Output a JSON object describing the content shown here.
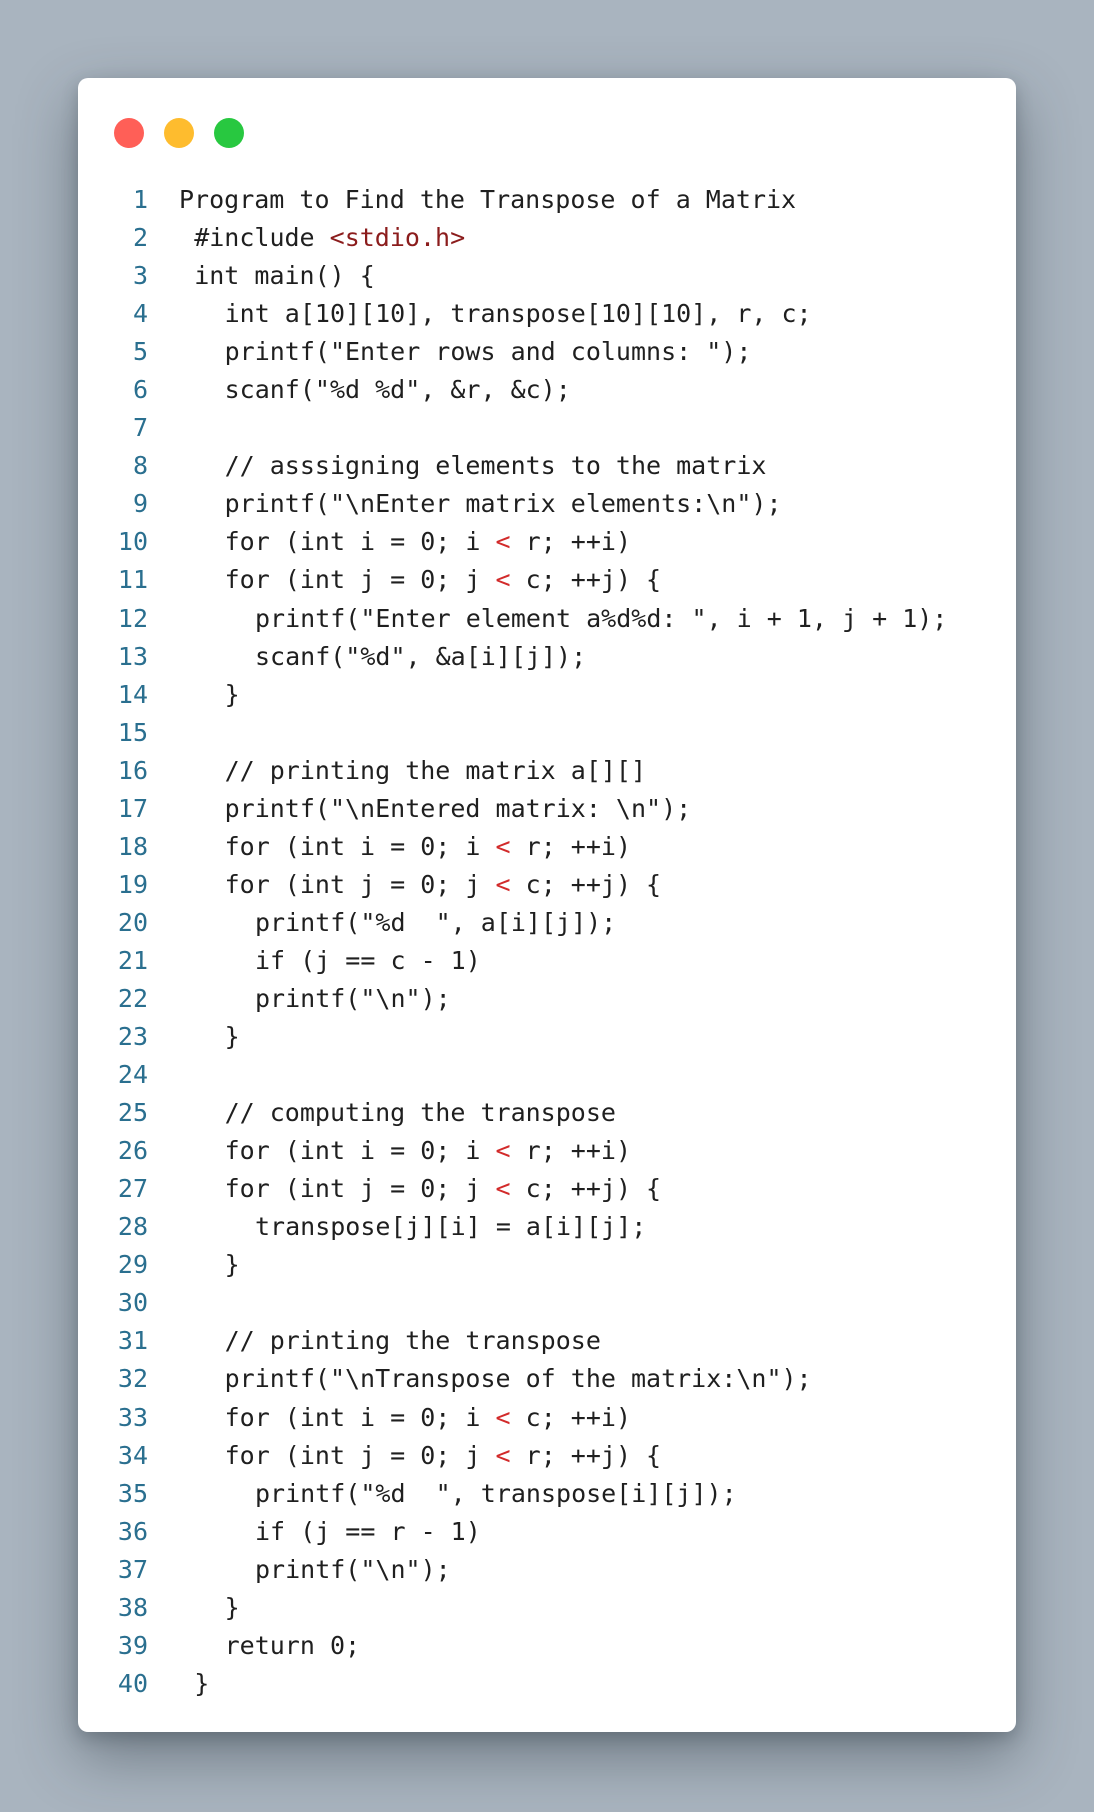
{
  "window": {
    "controls": [
      "close",
      "minimize",
      "maximize"
    ],
    "colors": {
      "close": "#ff5f57",
      "minimize": "#febc2e",
      "maximize": "#28c840"
    }
  },
  "code": {
    "language": "c",
    "line_number_color": "#2a6f8f",
    "lines": [
      {
        "n": "1",
        "indent": 0,
        "parts": [
          [
            "Program to Find the Transpose of a Matrix",
            ""
          ]
        ]
      },
      {
        "n": "2",
        "indent": 1,
        "parts": [
          [
            "#include ",
            ""
          ],
          [
            "<stdio.h>",
            "kw-str"
          ]
        ]
      },
      {
        "n": "3",
        "indent": 1,
        "parts": [
          [
            "int main() {",
            ""
          ]
        ]
      },
      {
        "n": "4",
        "indent": 3,
        "parts": [
          [
            "int a[10][10], transpose[10][10], r, c;",
            ""
          ]
        ]
      },
      {
        "n": "5",
        "indent": 3,
        "parts": [
          [
            "printf(\"Enter rows and columns: \");",
            ""
          ]
        ]
      },
      {
        "n": "6",
        "indent": 3,
        "parts": [
          [
            "scanf(\"%d %d\", &r, &c);",
            ""
          ]
        ]
      },
      {
        "n": "7",
        "indent": 0,
        "parts": []
      },
      {
        "n": "8",
        "indent": 3,
        "parts": [
          [
            "// asssigning elements to the matrix",
            ""
          ]
        ]
      },
      {
        "n": "9",
        "indent": 3,
        "parts": [
          [
            "printf(\"\\nEnter matrix elements:\\n\");",
            ""
          ]
        ]
      },
      {
        "n": "10",
        "indent": 3,
        "parts": [
          [
            "for (int i = 0; i ",
            ""
          ],
          [
            "<",
            "op"
          ],
          [
            " r; ++i)",
            ""
          ]
        ]
      },
      {
        "n": "11",
        "indent": 3,
        "parts": [
          [
            "for (int j = 0; j ",
            ""
          ],
          [
            "<",
            "op"
          ],
          [
            " c; ++j) {",
            ""
          ]
        ]
      },
      {
        "n": "12",
        "indent": 5,
        "parts": [
          [
            "printf(\"Enter element a%d%d: \", i + 1, j + 1);",
            ""
          ]
        ]
      },
      {
        "n": "13",
        "indent": 5,
        "parts": [
          [
            "scanf(\"%d\", &a[i][j]);",
            ""
          ]
        ]
      },
      {
        "n": "14",
        "indent": 3,
        "parts": [
          [
            "}",
            ""
          ]
        ]
      },
      {
        "n": "15",
        "indent": 0,
        "parts": []
      },
      {
        "n": "16",
        "indent": 3,
        "parts": [
          [
            "// printing the matrix a[][]",
            ""
          ]
        ]
      },
      {
        "n": "17",
        "indent": 3,
        "parts": [
          [
            "printf(\"\\nEntered matrix: \\n\");",
            ""
          ]
        ]
      },
      {
        "n": "18",
        "indent": 3,
        "parts": [
          [
            "for (int i = 0; i ",
            ""
          ],
          [
            "<",
            "op"
          ],
          [
            " r; ++i)",
            ""
          ]
        ]
      },
      {
        "n": "19",
        "indent": 3,
        "parts": [
          [
            "for (int j = 0; j ",
            ""
          ],
          [
            "<",
            "op"
          ],
          [
            " c; ++j) {",
            ""
          ]
        ]
      },
      {
        "n": "20",
        "indent": 5,
        "parts": [
          [
            "printf(\"%d  \", a[i][j]);",
            ""
          ]
        ]
      },
      {
        "n": "21",
        "indent": 5,
        "parts": [
          [
            "if (j == c - 1)",
            ""
          ]
        ]
      },
      {
        "n": "22",
        "indent": 5,
        "parts": [
          [
            "printf(\"\\n\");",
            ""
          ]
        ]
      },
      {
        "n": "23",
        "indent": 3,
        "parts": [
          [
            "}",
            ""
          ]
        ]
      },
      {
        "n": "24",
        "indent": 0,
        "parts": []
      },
      {
        "n": "25",
        "indent": 3,
        "parts": [
          [
            "// computing the transpose",
            ""
          ]
        ]
      },
      {
        "n": "26",
        "indent": 3,
        "parts": [
          [
            "for (int i = 0; i ",
            ""
          ],
          [
            "<",
            "op"
          ],
          [
            " r; ++i)",
            ""
          ]
        ]
      },
      {
        "n": "27",
        "indent": 3,
        "parts": [
          [
            "for (int j = 0; j ",
            ""
          ],
          [
            "<",
            "op"
          ],
          [
            " c; ++j) {",
            ""
          ]
        ]
      },
      {
        "n": "28",
        "indent": 5,
        "parts": [
          [
            "transpose[j][i] = a[i][j];",
            ""
          ]
        ]
      },
      {
        "n": "29",
        "indent": 3,
        "parts": [
          [
            "}",
            ""
          ]
        ]
      },
      {
        "n": "30",
        "indent": 0,
        "parts": []
      },
      {
        "n": "31",
        "indent": 3,
        "parts": [
          [
            "// printing the transpose",
            ""
          ]
        ]
      },
      {
        "n": "32",
        "indent": 3,
        "parts": [
          [
            "printf(\"\\nTranspose of the matrix:\\n\");",
            ""
          ]
        ]
      },
      {
        "n": "33",
        "indent": 3,
        "parts": [
          [
            "for (int i = 0; i ",
            ""
          ],
          [
            "<",
            "op"
          ],
          [
            " c; ++i)",
            ""
          ]
        ]
      },
      {
        "n": "34",
        "indent": 3,
        "parts": [
          [
            "for (int j = 0; j ",
            ""
          ],
          [
            "<",
            "op"
          ],
          [
            " r; ++j) {",
            ""
          ]
        ]
      },
      {
        "n": "35",
        "indent": 5,
        "parts": [
          [
            "printf(\"%d  \", transpose[i][j]);",
            ""
          ]
        ]
      },
      {
        "n": "36",
        "indent": 5,
        "parts": [
          [
            "if (j == r - 1)",
            ""
          ]
        ]
      },
      {
        "n": "37",
        "indent": 5,
        "parts": [
          [
            "printf(\"\\n\");",
            ""
          ]
        ]
      },
      {
        "n": "38",
        "indent": 3,
        "parts": [
          [
            "}",
            ""
          ]
        ]
      },
      {
        "n": "39",
        "indent": 3,
        "parts": [
          [
            "return 0;",
            ""
          ]
        ]
      },
      {
        "n": "40",
        "indent": 1,
        "parts": [
          [
            "}",
            ""
          ]
        ]
      }
    ]
  }
}
